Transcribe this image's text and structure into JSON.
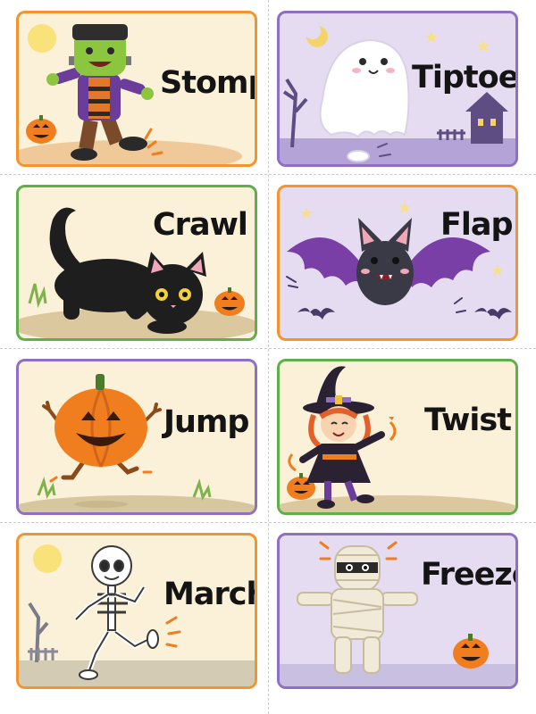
{
  "cards": [
    {
      "word": "Stomp",
      "character": "frankenstein-monster",
      "background": "#fbf0d8",
      "border": "#f2952e"
    },
    {
      "word": "Tiptoe",
      "character": "ghost",
      "background": "#e5dcf2",
      "border": "#8e6fc4"
    },
    {
      "word": "Crawl",
      "character": "black-cat",
      "background": "#fbf0d8",
      "border": "#5faf4a"
    },
    {
      "word": "Flap",
      "character": "bat",
      "background": "#e5dcf2",
      "border": "#f2952e"
    },
    {
      "word": "Jump",
      "character": "pumpkin",
      "background": "#fbf0d8",
      "border": "#8e6fc4"
    },
    {
      "word": "Twist",
      "character": "witch",
      "background": "#fbf0d8",
      "border": "#5faf4a"
    },
    {
      "word": "March",
      "character": "skeleton",
      "background": "#fbf0d8",
      "border": "#f2952e"
    },
    {
      "word": "Freeze",
      "character": "mummy",
      "background": "#e5dcf2",
      "border": "#8e6fc4"
    }
  ],
  "colors": {
    "pumpkin": "#f07d1e",
    "grass": "#7fb24a",
    "night": "#6b5a92"
  }
}
